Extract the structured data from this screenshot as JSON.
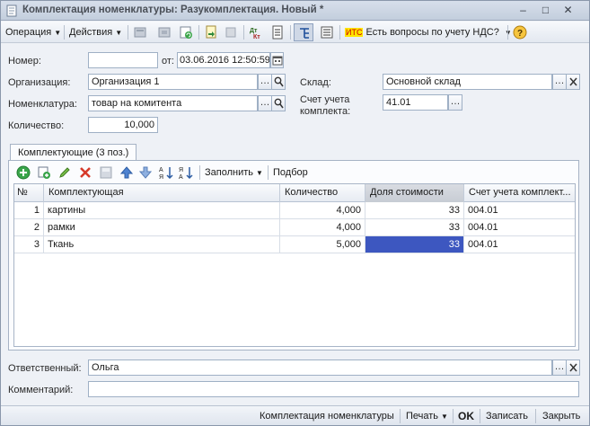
{
  "window": {
    "title": "Комплектация номенклатуры: Разукомплектация. Новый *",
    "btn_min": "–",
    "btn_max": "□",
    "btn_close": "✕"
  },
  "toolbar": {
    "operation": "Операция",
    "actions": "Действия",
    "its_badge": "ИТС",
    "vat_question": "Есть вопросы по учету НДС?"
  },
  "form": {
    "number_label": "Номер:",
    "number_value": "",
    "date_label": "от:",
    "date_value": "03.06.2016 12:50:59",
    "org_label": "Организация:",
    "org_value": "Организация 1",
    "warehouse_label": "Склад:",
    "warehouse_value": "Основной склад",
    "nomenclature_label": "Номенклатура:",
    "nomenclature_value": "товар на комитента",
    "account_label_1": "Счет учета",
    "account_label_2": "комплекта:",
    "account_value": "41.01",
    "qty_label": "Количество:",
    "qty_value": "10,000",
    "responsible_label": "Ответственный:",
    "responsible_value": "Ольга",
    "comment_label": "Комментарий:",
    "comment_value": ""
  },
  "tab": {
    "label": "Комплектующие (3 поз.)",
    "fill_label": "Заполнить",
    "select_label": "Подбор"
  },
  "grid": {
    "headers": [
      "№",
      "Комплектующая",
      "Количество",
      "Доля стоимости",
      "Счет учета комплект..."
    ],
    "rows": [
      {
        "n": "1",
        "item": "картины",
        "qty": "4,000",
        "share": "33",
        "account": "004.01"
      },
      {
        "n": "2",
        "item": "рамки",
        "qty": "4,000",
        "share": "33",
        "account": "004.01"
      },
      {
        "n": "3",
        "item": "Ткань",
        "qty": "5,000",
        "share": "33",
        "account": "004.01"
      }
    ]
  },
  "footer": {
    "doc_link": "Комплектация номенклатуры",
    "print": "Печать",
    "ok": "OK",
    "save": "Записать",
    "close": "Закрыть"
  },
  "colors": {
    "selection": "#3d57c0",
    "its_badge_bg": "#ffe600"
  }
}
